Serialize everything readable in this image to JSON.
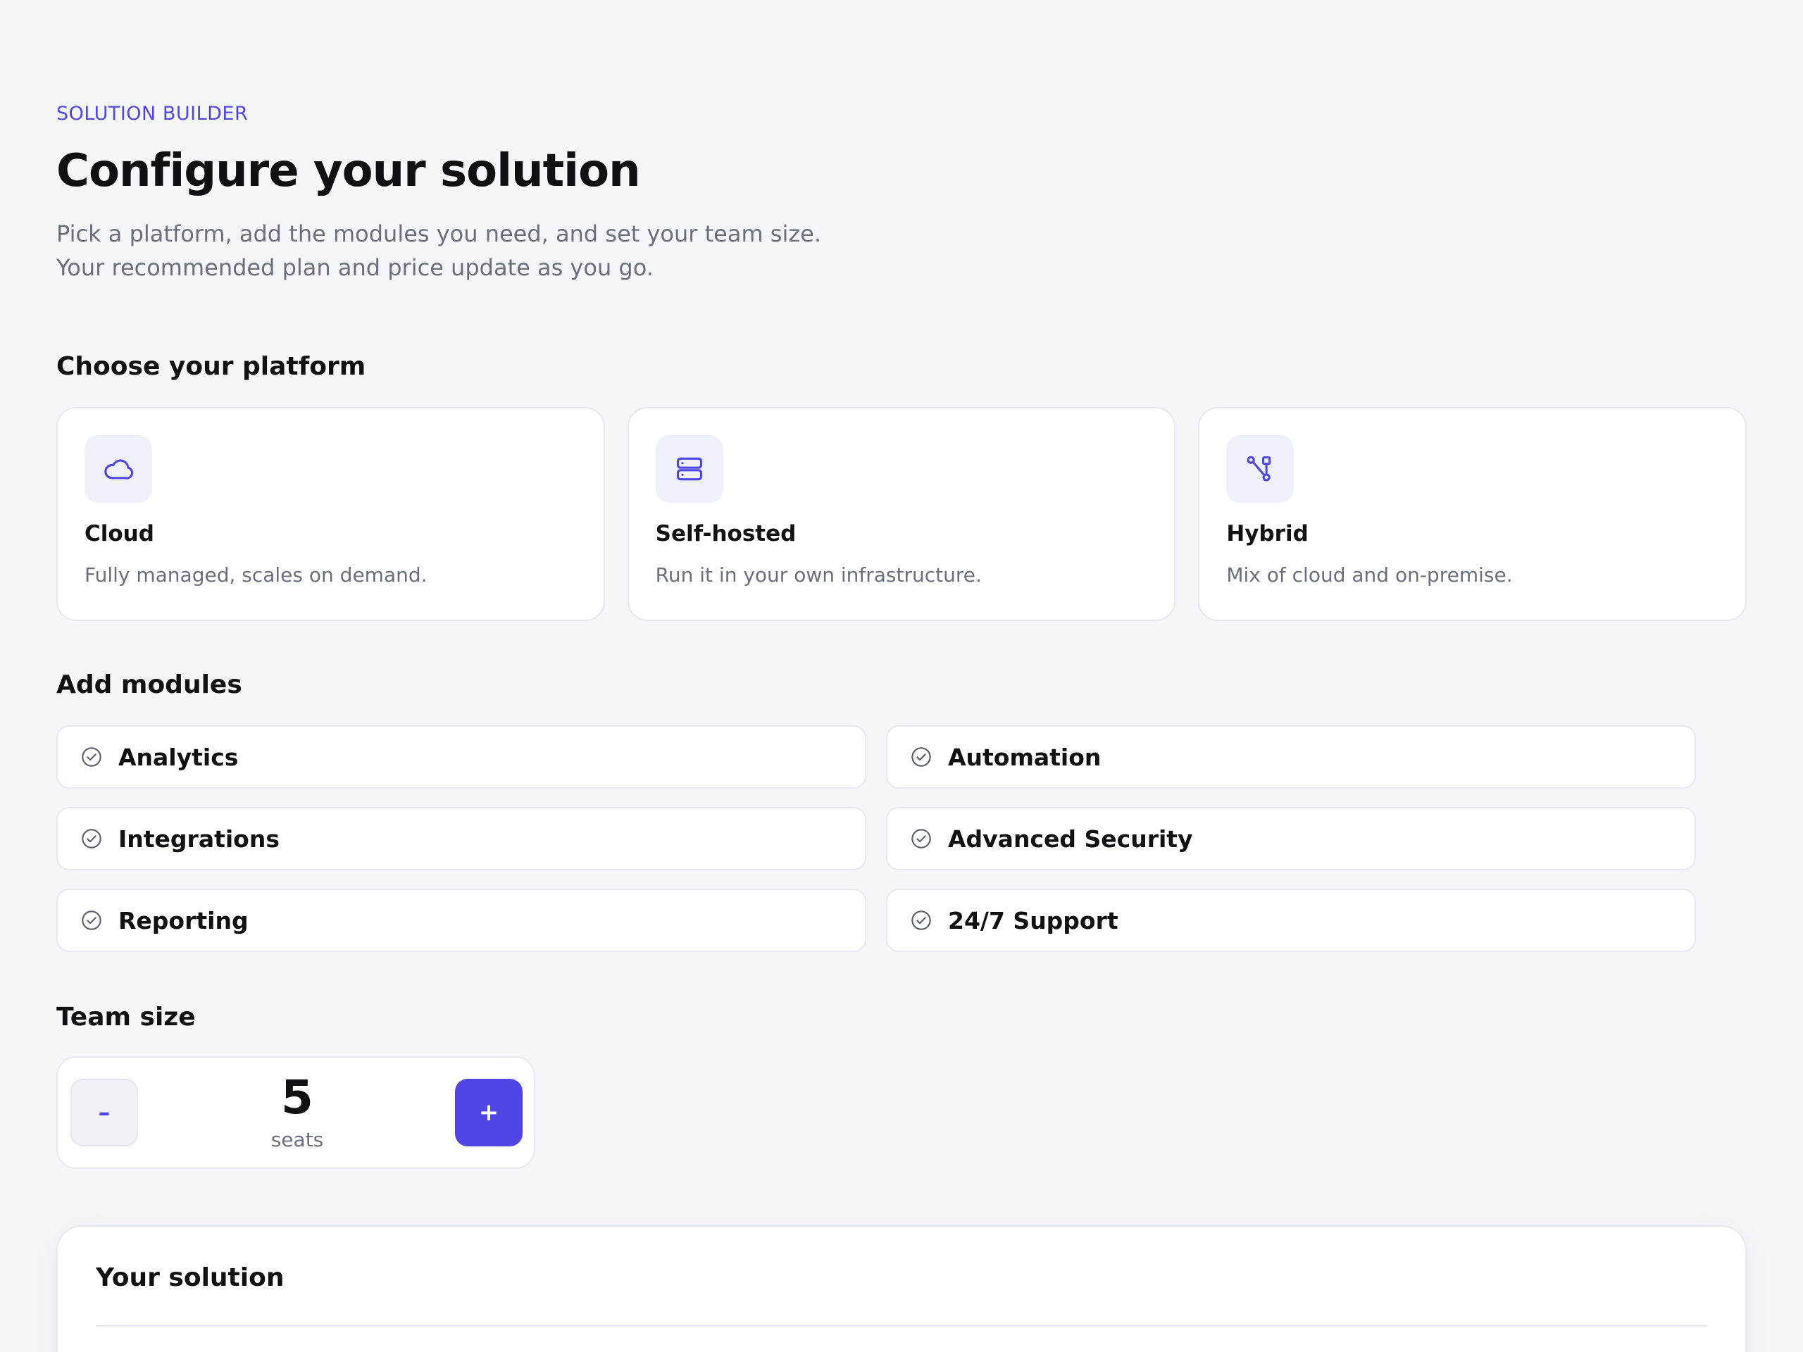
{
  "header": {
    "eyebrow": "SOLUTION BUILDER",
    "title": "Configure your solution",
    "subtitle": "Pick a platform, add the modules you need, and set your team size. Your recommended plan and price update as you go."
  },
  "platform_section": {
    "title": "Choose your platform",
    "options": [
      {
        "name": "Cloud",
        "description": "Fully managed, scales on demand.",
        "icon": "cloud-icon"
      },
      {
        "name": "Self-hosted",
        "description": "Run it in your own infrastructure.",
        "icon": "server-icon"
      },
      {
        "name": "Hybrid",
        "description": "Mix of cloud and on-premise.",
        "icon": "hybrid-network-icon"
      }
    ]
  },
  "modules_section": {
    "title": "Add modules",
    "items": [
      {
        "label": "Analytics"
      },
      {
        "label": "Automation"
      },
      {
        "label": "Integrations"
      },
      {
        "label": "Advanced Security"
      },
      {
        "label": "Reporting"
      },
      {
        "label": "24/7 Support"
      }
    ]
  },
  "team_section": {
    "title": "Team size",
    "decrement_label": "–",
    "increment_label": "+",
    "seats": "5",
    "unit": "seats"
  },
  "summary": {
    "title": "Your solution"
  },
  "colors": {
    "accent": "#4f46e5",
    "background": "#f5f6fa",
    "card": "#ffffff",
    "muted_text": "#6b6f7b"
  }
}
